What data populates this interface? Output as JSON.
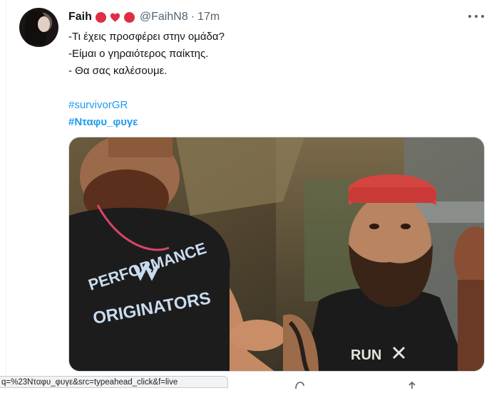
{
  "author": {
    "name": "Faih",
    "handle": "@FaihN8",
    "separator": "·",
    "time": "17m",
    "name_emoji": [
      "red-circle",
      "red-heart",
      "red-circle"
    ],
    "emoji_color": "#dd2e44"
  },
  "tweet": {
    "lines": [
      "-Τι έχεις προσφέρει στην ομάδα?",
      "-Είμαι ο γηραιότερος παίκτης.",
      "- Θα σας καλέσουμε."
    ],
    "hashtags": [
      "#survivorGR",
      "#Νταφυ_φυγε"
    ],
    "hashtag_color": "#1d9bf0"
  },
  "media": {
    "shirt_left_lines": [
      "PERFORMANCE",
      "ORIGINATORS"
    ],
    "shirt_right_text": "RUN"
  },
  "status_bar": {
    "url": "q=%23Νταφυ_φυγε&src=typeahead_click&f=live"
  },
  "icons": {
    "more": "more-horizontal-icon",
    "reply": "reply-icon",
    "share": "share-icon"
  }
}
